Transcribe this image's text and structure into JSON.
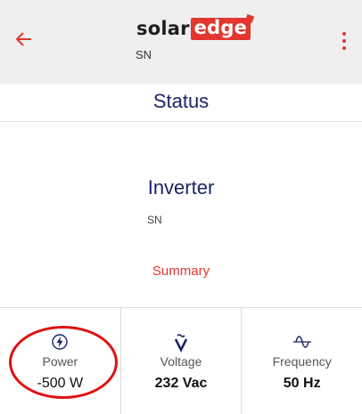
{
  "header": {
    "logo_text_part1": "solar",
    "logo_text_part2": "edge",
    "subtitle": "SN",
    "back_icon": "back-arrow-icon",
    "menu_icon": "more-vertical-icon",
    "accent_color": "#e2362f"
  },
  "status": {
    "title": "Status"
  },
  "inverter": {
    "title": "Inverter",
    "subtitle": "SN"
  },
  "summary": {
    "link_label": "Summary"
  },
  "metrics": [
    {
      "icon": "power-bolt-icon",
      "label": "Power",
      "value": "-500 W"
    },
    {
      "icon": "voltage-icon",
      "label": "Voltage",
      "value": "232 Vac"
    },
    {
      "icon": "frequency-wave-icon",
      "label": "Frequency",
      "value": "50 Hz"
    }
  ],
  "annotation": {
    "highlight_color": "#e01010"
  }
}
